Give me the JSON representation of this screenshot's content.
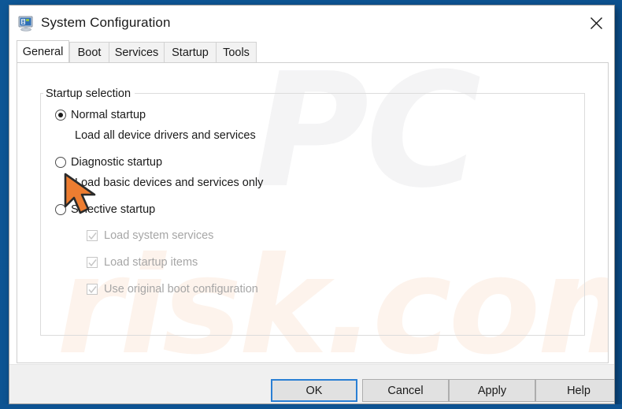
{
  "window": {
    "title": "System Configuration",
    "icon": "system-configuration-icon",
    "close_label": "✕"
  },
  "tabs": [
    {
      "label": "General",
      "selected": true
    },
    {
      "label": "Boot",
      "selected": false
    },
    {
      "label": "Services",
      "selected": false
    },
    {
      "label": "Startup",
      "selected": false
    },
    {
      "label": "Tools",
      "selected": false
    }
  ],
  "group": {
    "legend": "Startup selection"
  },
  "radios": [
    {
      "label": "Normal startup",
      "checked": true,
      "description": "Load all device drivers and services"
    },
    {
      "label": "Diagnostic startup",
      "checked": false,
      "description": "Load basic devices and services only"
    },
    {
      "label": "Selective startup",
      "checked": false,
      "description": ""
    }
  ],
  "checkboxes": [
    {
      "label": "Load system services",
      "checked": true,
      "enabled": false
    },
    {
      "label": "Load startup items",
      "checked": true,
      "enabled": false
    },
    {
      "label": "Use original boot configuration",
      "checked": true,
      "enabled": false
    }
  ],
  "buttons": [
    {
      "label": "OK",
      "default": true
    },
    {
      "label": "Cancel",
      "default": false
    },
    {
      "label": "Apply",
      "default": false
    },
    {
      "label": "Help",
      "default": false
    }
  ],
  "watermark": {
    "top": "PC",
    "bottom": "risk.com"
  },
  "cursor": {
    "type": "arrow-pointer",
    "color": "#ED7D31"
  },
  "colors": {
    "desktop": "#0d5392",
    "accent": "#2a7fd4",
    "window_bg": "#ffffff",
    "footer_bg": "#f0f0f0",
    "disabled_text": "#a6a6a6"
  }
}
